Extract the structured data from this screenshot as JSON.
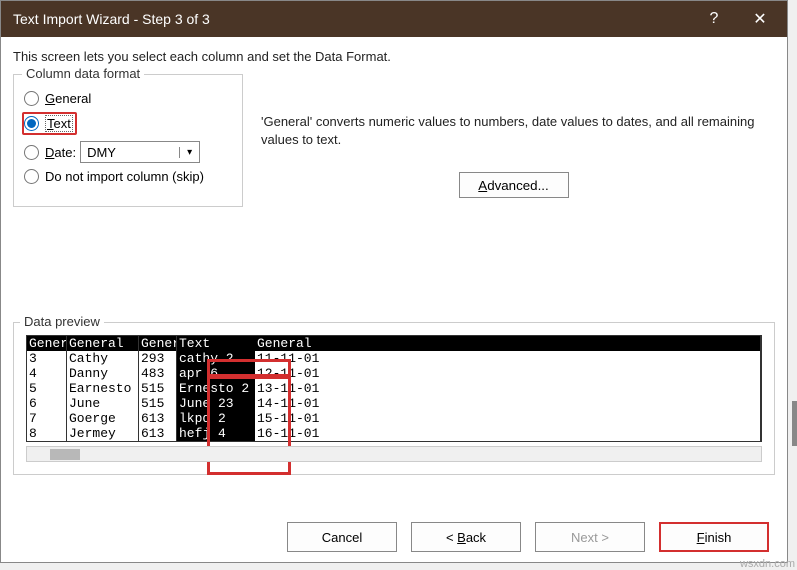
{
  "title": "Text Import Wizard - Step 3 of 3",
  "desc": "This screen lets you select each column and set the Data Format.",
  "format": {
    "legend": "Column data format",
    "general": "General",
    "text": "Text",
    "date": "Date:",
    "date_val": "DMY",
    "skip": "Do not import column (skip)"
  },
  "info_text": "'General' converts numeric values to numbers, date values to dates, and all remaining values to text.",
  "advanced": "Advanced...",
  "preview": {
    "legend": "Data preview",
    "headers": [
      "Gener",
      "General",
      "Gener",
      "Text",
      "General"
    ],
    "rows": [
      [
        "3",
        "Cathy",
        "293",
        "cathy 2",
        "11-11-01"
      ],
      [
        "4",
        "Danny",
        "483",
        "apr 6",
        "12-11-01"
      ],
      [
        "5",
        "Earnesto",
        "515",
        "Ernesto 2",
        "13-11-01"
      ],
      [
        "6",
        "June",
        "515",
        "June 23",
        "14-11-01"
      ],
      [
        "7",
        "Goerge",
        "613",
        "lkpd 2",
        "15-11-01"
      ],
      [
        "8",
        "Jermey",
        "613",
        "hefj 4",
        "16-11-01"
      ]
    ]
  },
  "buttons": {
    "cancel": "Cancel",
    "back": "< Back",
    "next": "Next >",
    "finish": "Finish"
  },
  "watermark": "wsxdn.com",
  "u": {
    "g": "G",
    "t": "T",
    "d": "D",
    "a": "A",
    "b": "B",
    "f": "F"
  }
}
